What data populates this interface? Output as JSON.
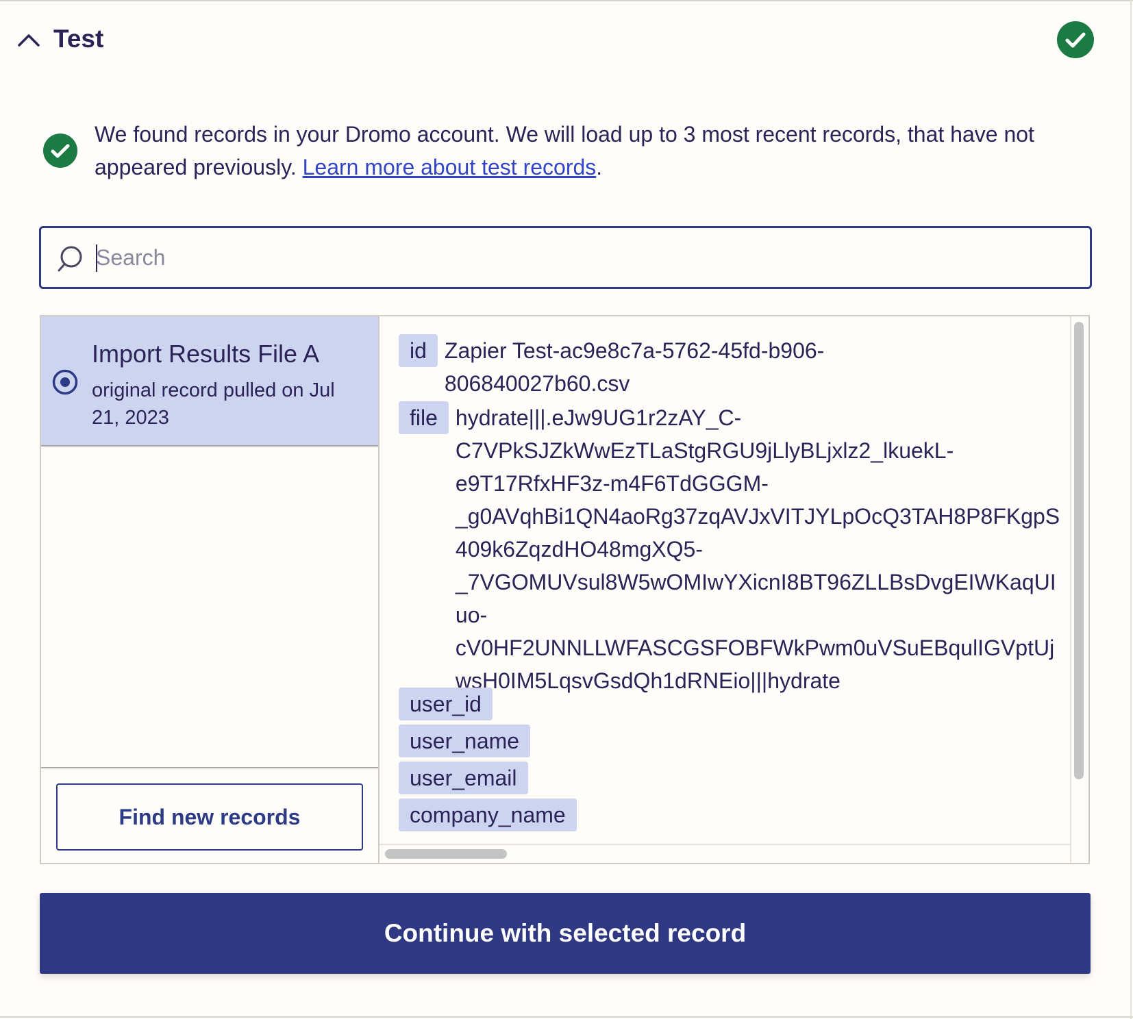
{
  "header": {
    "title": "Test"
  },
  "colors": {
    "success_green": "#1c7a43",
    "primary": "#2f3883",
    "selected_bg": "#cdd4f0",
    "link": "#3145c4"
  },
  "notice": {
    "text": "We found records in your Dromo account. We will load up to 3 most recent records, that have not appeared previously. ",
    "link_text": "Learn more about test records",
    "suffix": "."
  },
  "search": {
    "placeholder": "Search",
    "value": ""
  },
  "records": [
    {
      "title": "Import Results File A",
      "subtitle": "original record pulled on Jul 21, 2023",
      "selected": true
    }
  ],
  "find_new_label": "Find new records",
  "fields": [
    {
      "key": "id",
      "value": "Zapier Test-ac9e8c7a-5762-45fd-b906-\n806840027b60.csv"
    },
    {
      "key": "file",
      "value": "hydrate|||.eJw9UG1r2zAY_C-\nC7VPkSJZkWwEzTLaStgRGU9jLlyBLjxlz2_lkuekL-\ne9T17RfxHF3z-m4F6TdGGGM-\n_g0AVqhBi1QN4aoRg37zqAVJxVITJYLpOcQ3TAH8P8FKgpS\n409k6ZqzdHO48mgXQ5-\n_7VGOMUVsul8W5wOMIwYXicnI8BT96ZLLBsDvgEIWKaqUI\nuo-\ncV0HF2UNNLLWFASCGSFOBFWkPwm0uVSuEBqulIGVptUj\nwsH0IM5LqsvGsdQh1dRNEio|||hydrate"
    },
    {
      "key": "user_id",
      "value": ""
    },
    {
      "key": "user_name",
      "value": ""
    },
    {
      "key": "user_email",
      "value": ""
    },
    {
      "key": "company_name",
      "value": ""
    }
  ],
  "continue_label": "Continue with selected record"
}
